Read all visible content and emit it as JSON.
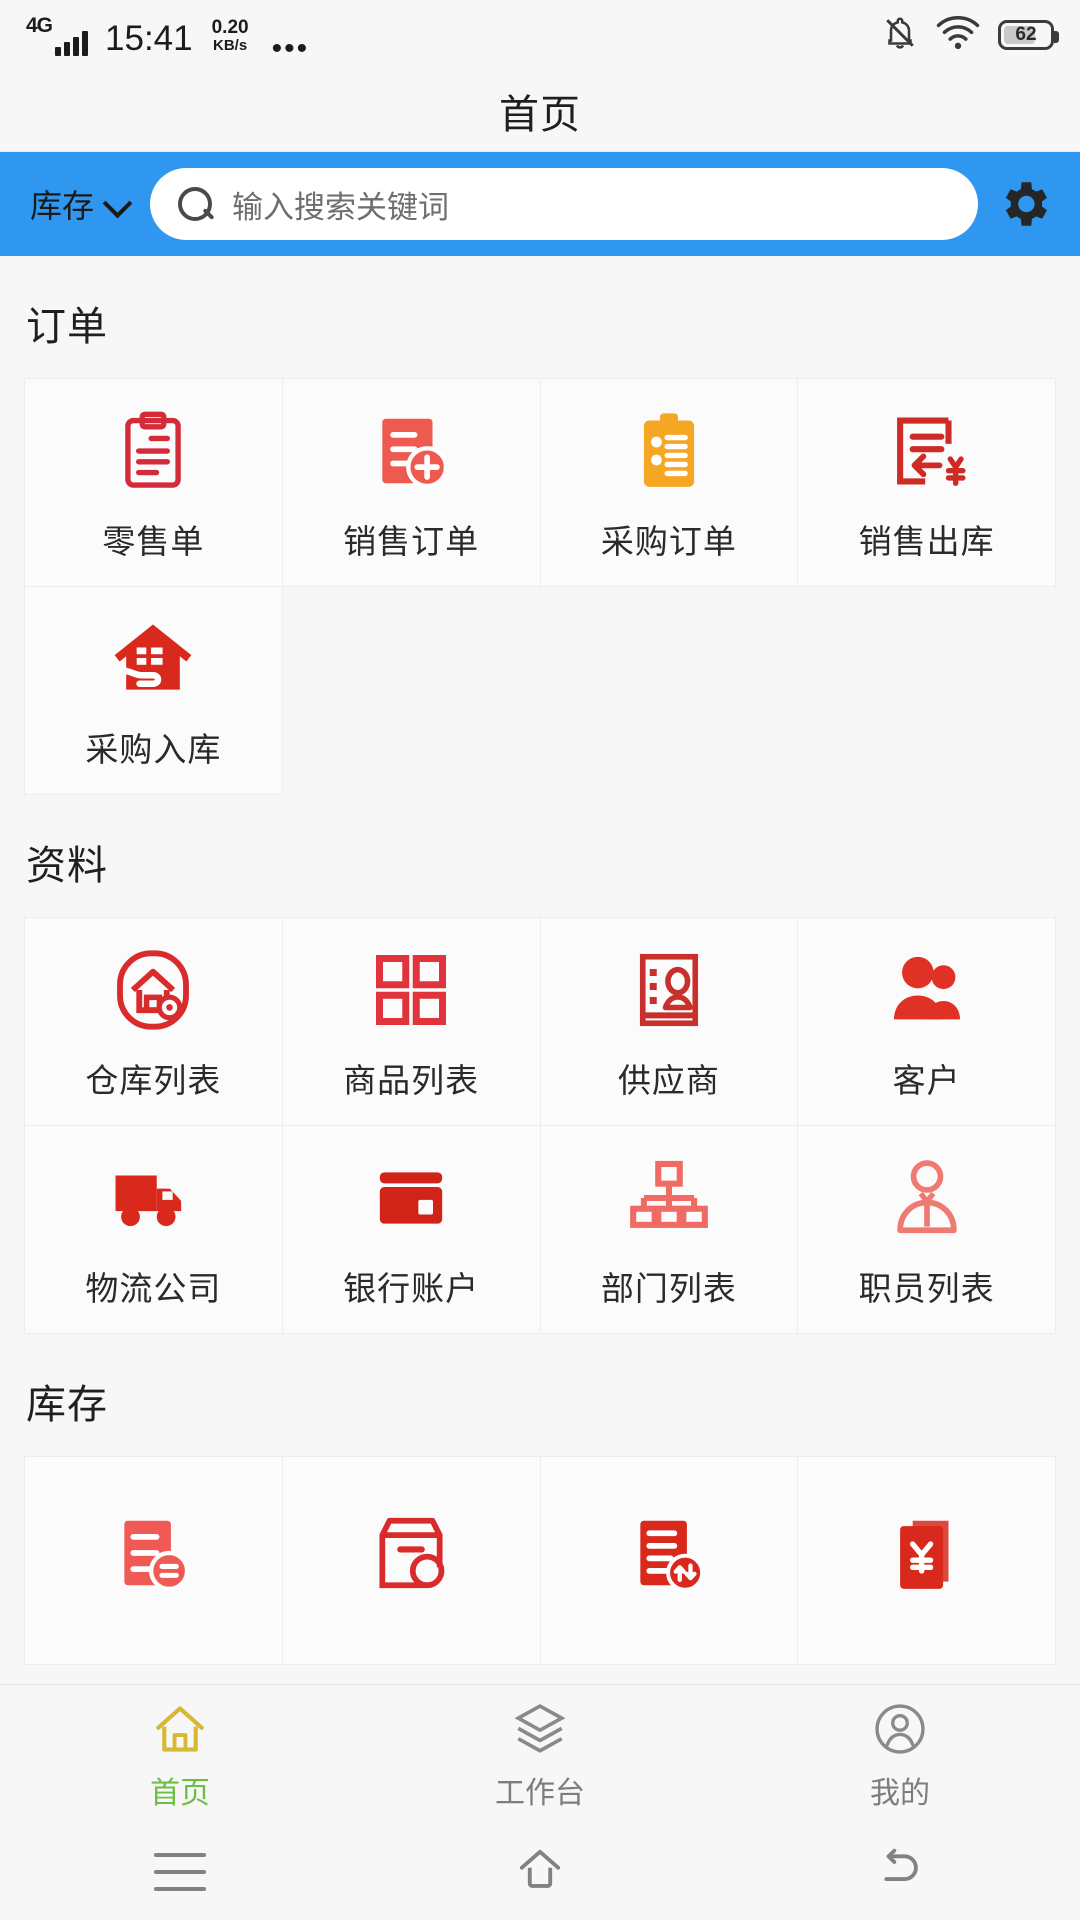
{
  "status_bar": {
    "network_type": "4G",
    "time": "15:41",
    "speed_value": "0.20",
    "speed_unit": "KB/s",
    "overflow_dots": "•••",
    "battery_percent": "62",
    "icons": [
      "signal-bars-icon",
      "bell-muted-icon",
      "wifi-icon",
      "battery-icon"
    ]
  },
  "header": {
    "title": "首页"
  },
  "search": {
    "scope_label": "库存",
    "placeholder": "输入搜索关键词",
    "value": "",
    "settings_icon": "gear-icon",
    "bar_color": "#2f97ef"
  },
  "sections": [
    {
      "title": "订单",
      "items": [
        {
          "label": "零售单",
          "icon": "clipboard-outline-icon",
          "color": "#d32b3a"
        },
        {
          "label": "销售订单",
          "icon": "document-plus-icon",
          "color": "#ef5a50"
        },
        {
          "label": "采购订单",
          "icon": "clipboard-checklist-icon",
          "color": "#f5a623"
        },
        {
          "label": "销售出库",
          "icon": "document-arrow-yuan-icon",
          "color": "#cf2b25"
        },
        {
          "label": "采购入库",
          "icon": "house-hand-icon",
          "color": "#d8291c"
        }
      ]
    },
    {
      "title": "资料",
      "items": [
        {
          "label": "仓库列表",
          "icon": "warehouse-gear-icon",
          "color": "#d92b2b"
        },
        {
          "label": "商品列表",
          "icon": "grid-squares-icon",
          "color": "#e0333b"
        },
        {
          "label": "供应商",
          "icon": "contact-card-icon",
          "color": "#c9302c"
        },
        {
          "label": "客户",
          "icon": "two-people-icon",
          "color": "#e03127"
        },
        {
          "label": "物流公司",
          "icon": "truck-icon",
          "color": "#d8291c"
        },
        {
          "label": "银行账户",
          "icon": "bank-card-icon",
          "color": "#cf2417"
        },
        {
          "label": "部门列表",
          "icon": "org-chart-icon",
          "color": "#ef6b63"
        },
        {
          "label": "职员列表",
          "icon": "employee-icon",
          "color": "#ef7a72"
        }
      ]
    },
    {
      "title": "库存",
      "items": [
        {
          "label": "",
          "icon": "document-recycle-icon",
          "color": "#ef5a55"
        },
        {
          "label": "",
          "icon": "box-search-icon",
          "color": "#d92b2b"
        },
        {
          "label": "",
          "icon": "document-transfer-icon",
          "color": "#d8291c"
        },
        {
          "label": "",
          "icon": "yuan-books-icon",
          "color": "#d8291c"
        }
      ]
    }
  ],
  "tabbar": {
    "items": [
      {
        "label": "首页",
        "icon": "home-icon",
        "active": true
      },
      {
        "label": "工作台",
        "icon": "layers-icon",
        "active": false
      },
      {
        "label": "我的",
        "icon": "person-circle-icon",
        "active": false
      }
    ],
    "active_label_color": "#6cbf45",
    "active_icon_color": "#d8b733",
    "inactive_color": "#7d7d7d"
  },
  "android_nav": {
    "items": [
      "menu-icon",
      "home-outline-icon",
      "back-icon"
    ]
  }
}
